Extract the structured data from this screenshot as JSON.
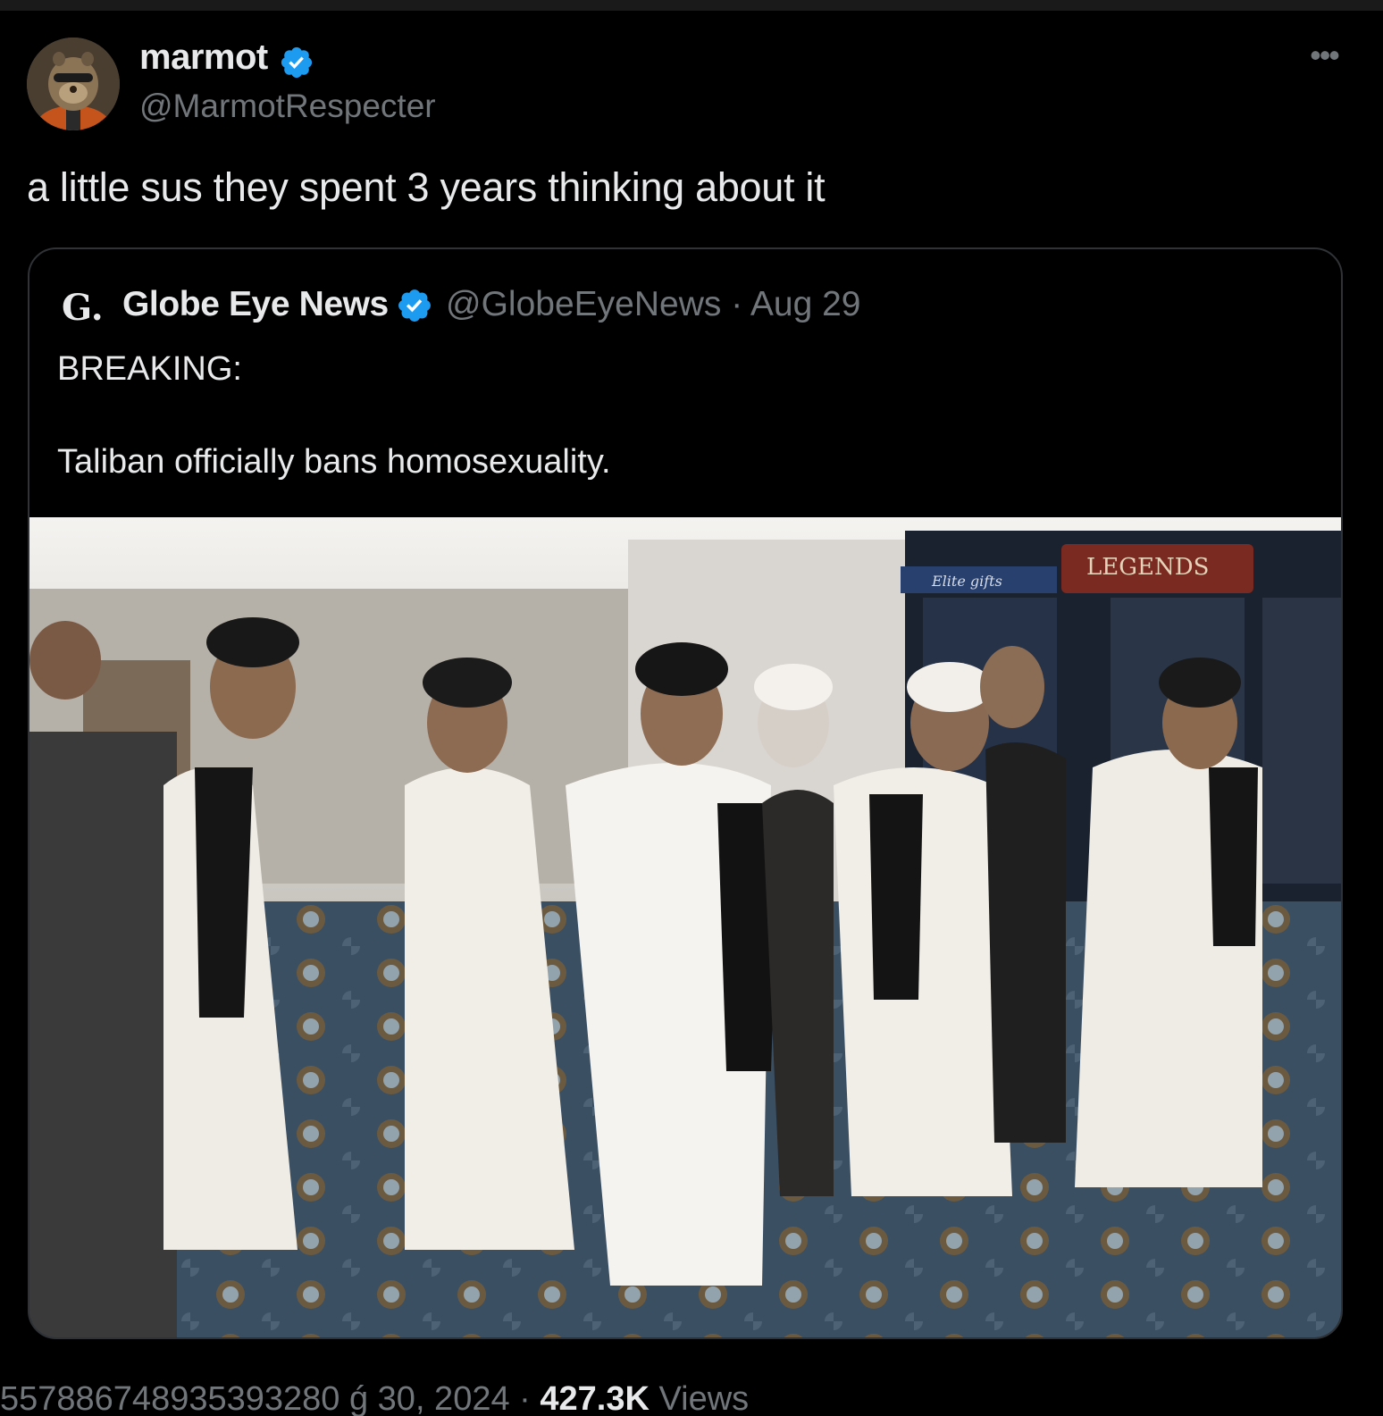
{
  "tweet": {
    "author": {
      "display_name": "marmot",
      "handle": "@MarmotRespecter",
      "verified": true
    },
    "text": "a little sus they spent 3 years thinking about it",
    "more_icon": "more-horizontal-icon",
    "meta": {
      "id_fragment": "557886748935393280",
      "date_fragment": "ǵ 30, 2024 ·",
      "views_count": "427.3K",
      "views_label": "Views"
    }
  },
  "quote": {
    "logo_text": "G.",
    "display_name": "Globe Eye News",
    "handle_date": "@GlobeEyeNews · Aug 29",
    "verified": true,
    "text": "BREAKING:\n\nTaliban officially bans homosexuality.",
    "image_signs": {
      "left": "Elite gifts",
      "center": "LEGENDS"
    }
  },
  "colors": {
    "background": "#000000",
    "text_primary": "#e7e9ea",
    "text_secondary": "#71767b",
    "verified_blue": "#1d9bf0",
    "card_border": "#2f3336"
  }
}
